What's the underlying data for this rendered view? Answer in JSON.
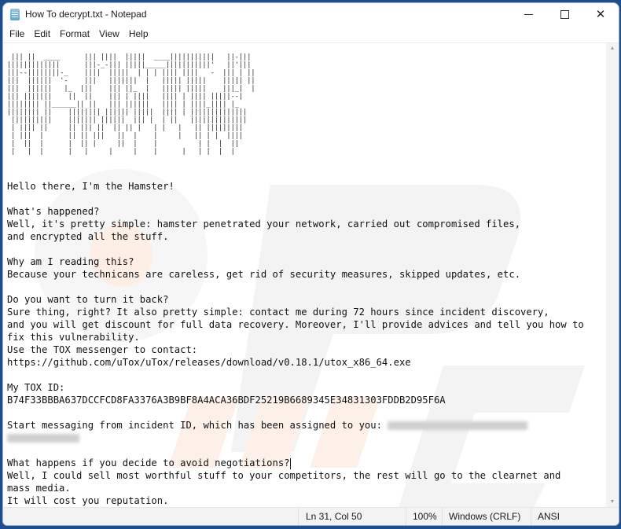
{
  "window": {
    "title": "How To decrypt.txt - Notepad",
    "app_icon": "notepad-icon",
    "controls": {
      "minimize": "minimize-icon",
      "maximize": "maximize-icon",
      "close": "close-icon",
      "close_glyph": "✕"
    }
  },
  "menu": {
    "items": [
      "File",
      "Edit",
      "Format",
      "View",
      "Help"
    ]
  },
  "document": {
    "ascii_art": [
      " ||| ||  ____      ||| ||||  |||||  ____|||||||||||   ||-|||",
      "|||||||||||||      |||-_-||| |||||_____|||||||||||'   ||'|||",
      "|||--||||||||-_    ||||  |||||  | | | |||| ||||   -  ||| | ||",
      "|||  ||||||  '-    |||   |||||||  |   ||||| |||||    ||||| ||",
      "|||  ||||||   |_  |||    ||| ||_  |   ||||| |||||    |||_|  |",
      "||| |||||||    ||  ||    ||| | ||||   |||| | |||| |||||--|   ",
      "|||||||| ||______|| ||   ||| ||||||   |||| | ||||_|||| |_    ",
      "|||||||| ||    |||||||| |||||| |||||  |||| | |||||||||||||| ",
      " ||||||||||    ||||||| ||||||  ||| |  | ||   |||||||||||||| ",
      " | |||| ||     || ||| ||  || || |   | |   |   || ||||||||| ",
      " | |||  |      || || |||   ||  |    |     |   || | |  ||||  ",
      " |  ||  |      |  || |     ||  |    |          | |  |  ||   ",
      " |   |  |      |   |     |     |    |      |   | |  |  |    "
    ],
    "lines": [
      "Hello there, I'm the Hamster!",
      "",
      "What's happened?",
      "Well, it's pretty simple: hamster penetrated your network, carried out compromised files,",
      "and encrypted all the stuff.",
      "",
      "Why am I reading this?",
      "Because your technicans are careless, get rid of security measures, skipped updates, etc.",
      "",
      "Do you want to turn it back?",
      "Sure thing, right? It also pretty simple: contact me during 72 hours since incident discovery,",
      "and you will get discount for full data recovery. Moreover, I'll provide advices and tell you how to",
      "fix this vulnerability.",
      "Use the TOX messenger to contact:",
      "https://github.com/uTox/uTox/releases/download/v0.18.1/utox_x86_64.exe",
      "",
      "My TOX ID:",
      "B74F33BBBA637DCCFCD8FA3376A3B9BF8A4ACA36BDF25219B6689345E34831303FDDB2D95F6A",
      "",
      "Start messaging from incident ID, which has been assigned to you: "
    ],
    "redacted_note": "incident ID redacted (blurred)",
    "lines_after": [
      "",
      "What happens if you decide to avoid negotiations?",
      "Well, I could sell most worthful stuff to your competitors, the rest will go to the clearnet and",
      "mass media.",
      "It will cost you reputation."
    ]
  },
  "scrollbar": {
    "up_glyph": "▲",
    "down_glyph": "▼"
  },
  "statusbar": {
    "position": "Ln 31, Col 50",
    "zoom": "100%",
    "line_ending": "Windows (CRLF)",
    "encoding": "ANSI"
  },
  "colors": {
    "frame": "#1d4f8f",
    "watermark": "#f0f0f0"
  }
}
